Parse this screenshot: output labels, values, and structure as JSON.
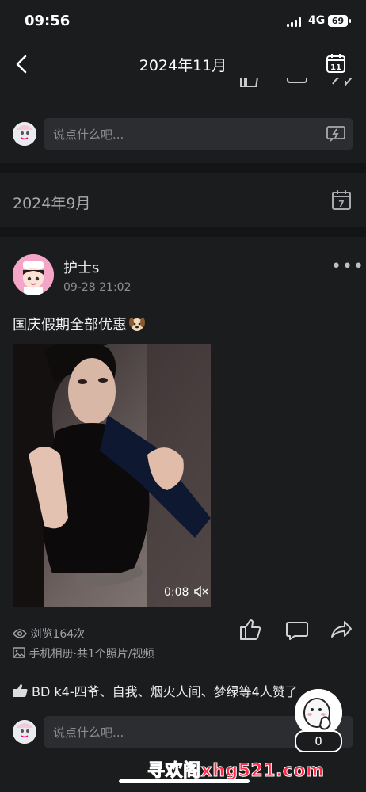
{
  "status_bar": {
    "time": "09:56",
    "network": "4G",
    "battery": "69"
  },
  "nav": {
    "title": "2024年11月",
    "calendar_day": "11"
  },
  "comment_bar": {
    "placeholder": "说点什么吧..."
  },
  "month_header": {
    "label": "2024年9月",
    "calendar_day": "7"
  },
  "post": {
    "username": "护士s",
    "time": "09-28 21:02",
    "text": "国庆假期全部优惠",
    "video_duration": "0:08",
    "views": "浏览164次",
    "album_info": "手机相册·共1个照片/视频",
    "likes_text": "BD  k4-四爷、自我、烟火人间、梦绿等4人赞了"
  },
  "float_widget": {
    "count": "0"
  },
  "watermark": "寻欢阁xhg521.com",
  "colors": {
    "background": "#1b1c1e",
    "separator": "#131415",
    "watermark": "#ff2a47"
  }
}
